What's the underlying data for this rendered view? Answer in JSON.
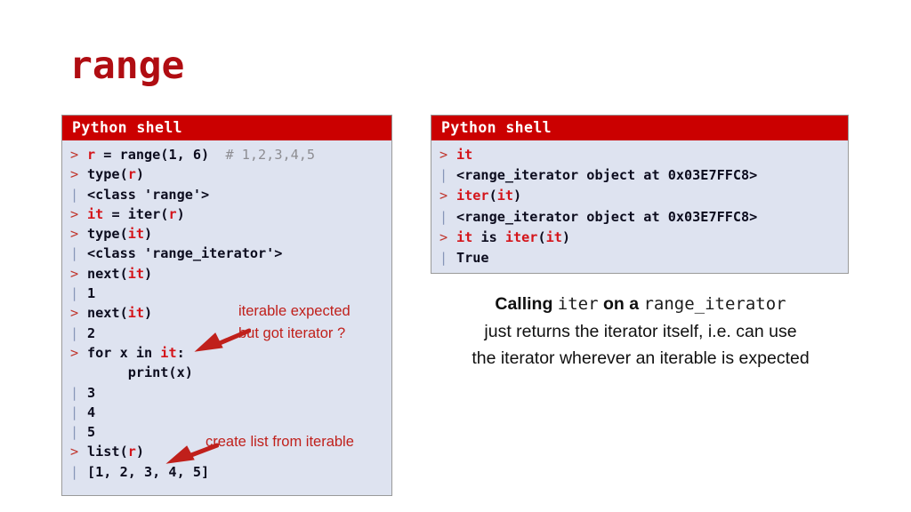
{
  "slide": {
    "title": "range",
    "title_color": "#B00D12",
    "background": "#FFFFFF"
  },
  "colors": {
    "shell_header_bg": "#CB0000",
    "shell_header_text": "#FFFFFF",
    "shell_body_bg": "#DEE3F0",
    "shell_border": "#9A9A9A",
    "prompt_marker": "#C0342B",
    "output_marker": "#8796B8",
    "code_text": "#0C0C1E",
    "identifier_red": "#D4141A",
    "comment_gray": "#8D8D92",
    "annotation_red": "#C0201B",
    "caption_text": "#101010"
  },
  "left_shell": {
    "header": "Python shell",
    "lines": [
      {
        "marker": ">",
        "kind": "prompt",
        "parts": [
          {
            "t": "code",
            "s": ""
          },
          {
            "t": "var",
            "s": "r"
          },
          {
            "t": "code",
            "s": " = range(1, 6)  "
          },
          {
            "t": "cmt",
            "s": "# 1,2,3,4,5"
          }
        ]
      },
      {
        "marker": ">",
        "kind": "prompt",
        "parts": [
          {
            "t": "code",
            "s": "type("
          },
          {
            "t": "var",
            "s": "r"
          },
          {
            "t": "code",
            "s": ")"
          }
        ]
      },
      {
        "marker": "|",
        "kind": "out",
        "parts": [
          {
            "t": "code",
            "s": "<class 'range'>"
          }
        ]
      },
      {
        "marker": ">",
        "kind": "prompt",
        "parts": [
          {
            "t": "var",
            "s": "it"
          },
          {
            "t": "code",
            "s": " = iter("
          },
          {
            "t": "var",
            "s": "r"
          },
          {
            "t": "code",
            "s": ")"
          }
        ]
      },
      {
        "marker": ">",
        "kind": "prompt",
        "parts": [
          {
            "t": "code",
            "s": "type("
          },
          {
            "t": "var",
            "s": "it"
          },
          {
            "t": "code",
            "s": ")"
          }
        ]
      },
      {
        "marker": "|",
        "kind": "out",
        "parts": [
          {
            "t": "code",
            "s": "<class 'range_iterator'>"
          }
        ]
      },
      {
        "marker": ">",
        "kind": "prompt",
        "parts": [
          {
            "t": "code",
            "s": "next("
          },
          {
            "t": "var",
            "s": "it"
          },
          {
            "t": "code",
            "s": ")"
          }
        ]
      },
      {
        "marker": "|",
        "kind": "out",
        "parts": [
          {
            "t": "code",
            "s": "1"
          }
        ]
      },
      {
        "marker": ">",
        "kind": "prompt",
        "parts": [
          {
            "t": "code",
            "s": "next("
          },
          {
            "t": "var",
            "s": "it"
          },
          {
            "t": "code",
            "s": ")"
          }
        ]
      },
      {
        "marker": "|",
        "kind": "out",
        "parts": [
          {
            "t": "code",
            "s": "2"
          }
        ]
      },
      {
        "marker": ">",
        "kind": "prompt",
        "parts": [
          {
            "t": "code",
            "s": "for x in "
          },
          {
            "t": "var",
            "s": "it"
          },
          {
            "t": "code",
            "s": ":"
          }
        ]
      },
      {
        "marker": " ",
        "kind": "blank",
        "parts": [
          {
            "t": "code",
            "s": "     print(x)"
          }
        ]
      },
      {
        "marker": "|",
        "kind": "out",
        "parts": [
          {
            "t": "code",
            "s": "3"
          }
        ]
      },
      {
        "marker": "|",
        "kind": "out",
        "parts": [
          {
            "t": "code",
            "s": "4"
          }
        ]
      },
      {
        "marker": "|",
        "kind": "out",
        "parts": [
          {
            "t": "code",
            "s": "5"
          }
        ]
      },
      {
        "marker": ">",
        "kind": "prompt",
        "parts": [
          {
            "t": "code",
            "s": "list("
          },
          {
            "t": "var",
            "s": "r"
          },
          {
            "t": "code",
            "s": ")"
          }
        ]
      },
      {
        "marker": "|",
        "kind": "out",
        "parts": [
          {
            "t": "code",
            "s": "[1, 2, 3, 4, 5]"
          }
        ]
      }
    ]
  },
  "right_shell": {
    "header": "Python shell",
    "lines": [
      {
        "marker": ">",
        "kind": "prompt",
        "parts": [
          {
            "t": "var",
            "s": "it"
          }
        ]
      },
      {
        "marker": "|",
        "kind": "out",
        "parts": [
          {
            "t": "code",
            "s": "<range_iterator object at 0x03E7FFC8>"
          }
        ]
      },
      {
        "marker": ">",
        "kind": "prompt",
        "parts": [
          {
            "t": "var",
            "s": "iter"
          },
          {
            "t": "code",
            "s": "("
          },
          {
            "t": "var",
            "s": "it"
          },
          {
            "t": "code",
            "s": ")"
          }
        ]
      },
      {
        "marker": "|",
        "kind": "out",
        "parts": [
          {
            "t": "code",
            "s": "<range_iterator object at 0x03E7FFC8>"
          }
        ]
      },
      {
        "marker": ">",
        "kind": "prompt",
        "parts": [
          {
            "t": "var",
            "s": "it"
          },
          {
            "t": "code",
            "s": " is "
          },
          {
            "t": "var",
            "s": "iter"
          },
          {
            "t": "code",
            "s": "("
          },
          {
            "t": "var",
            "s": "it"
          },
          {
            "t": "code",
            "s": ")"
          }
        ]
      },
      {
        "marker": "|",
        "kind": "out",
        "parts": [
          {
            "t": "code",
            "s": "True"
          }
        ]
      }
    ]
  },
  "annotations": [
    {
      "id": "iterable-expected-line1",
      "text": "iterable expected"
    },
    {
      "id": "iterable-expected-line2",
      "text": "but got iterator ?"
    },
    {
      "id": "create-list",
      "text": "create list from iterable"
    }
  ],
  "caption": {
    "line1": [
      {
        "style": "bold",
        "s": "Calling "
      },
      {
        "style": "mono",
        "s": "iter"
      },
      {
        "style": "bold",
        "s": " on a "
      },
      {
        "style": "mono",
        "s": "range_iterator"
      }
    ],
    "line2": "just returns the iterator itself, i.e. can use",
    "line3": "the iterator wherever an iterable is expected"
  }
}
